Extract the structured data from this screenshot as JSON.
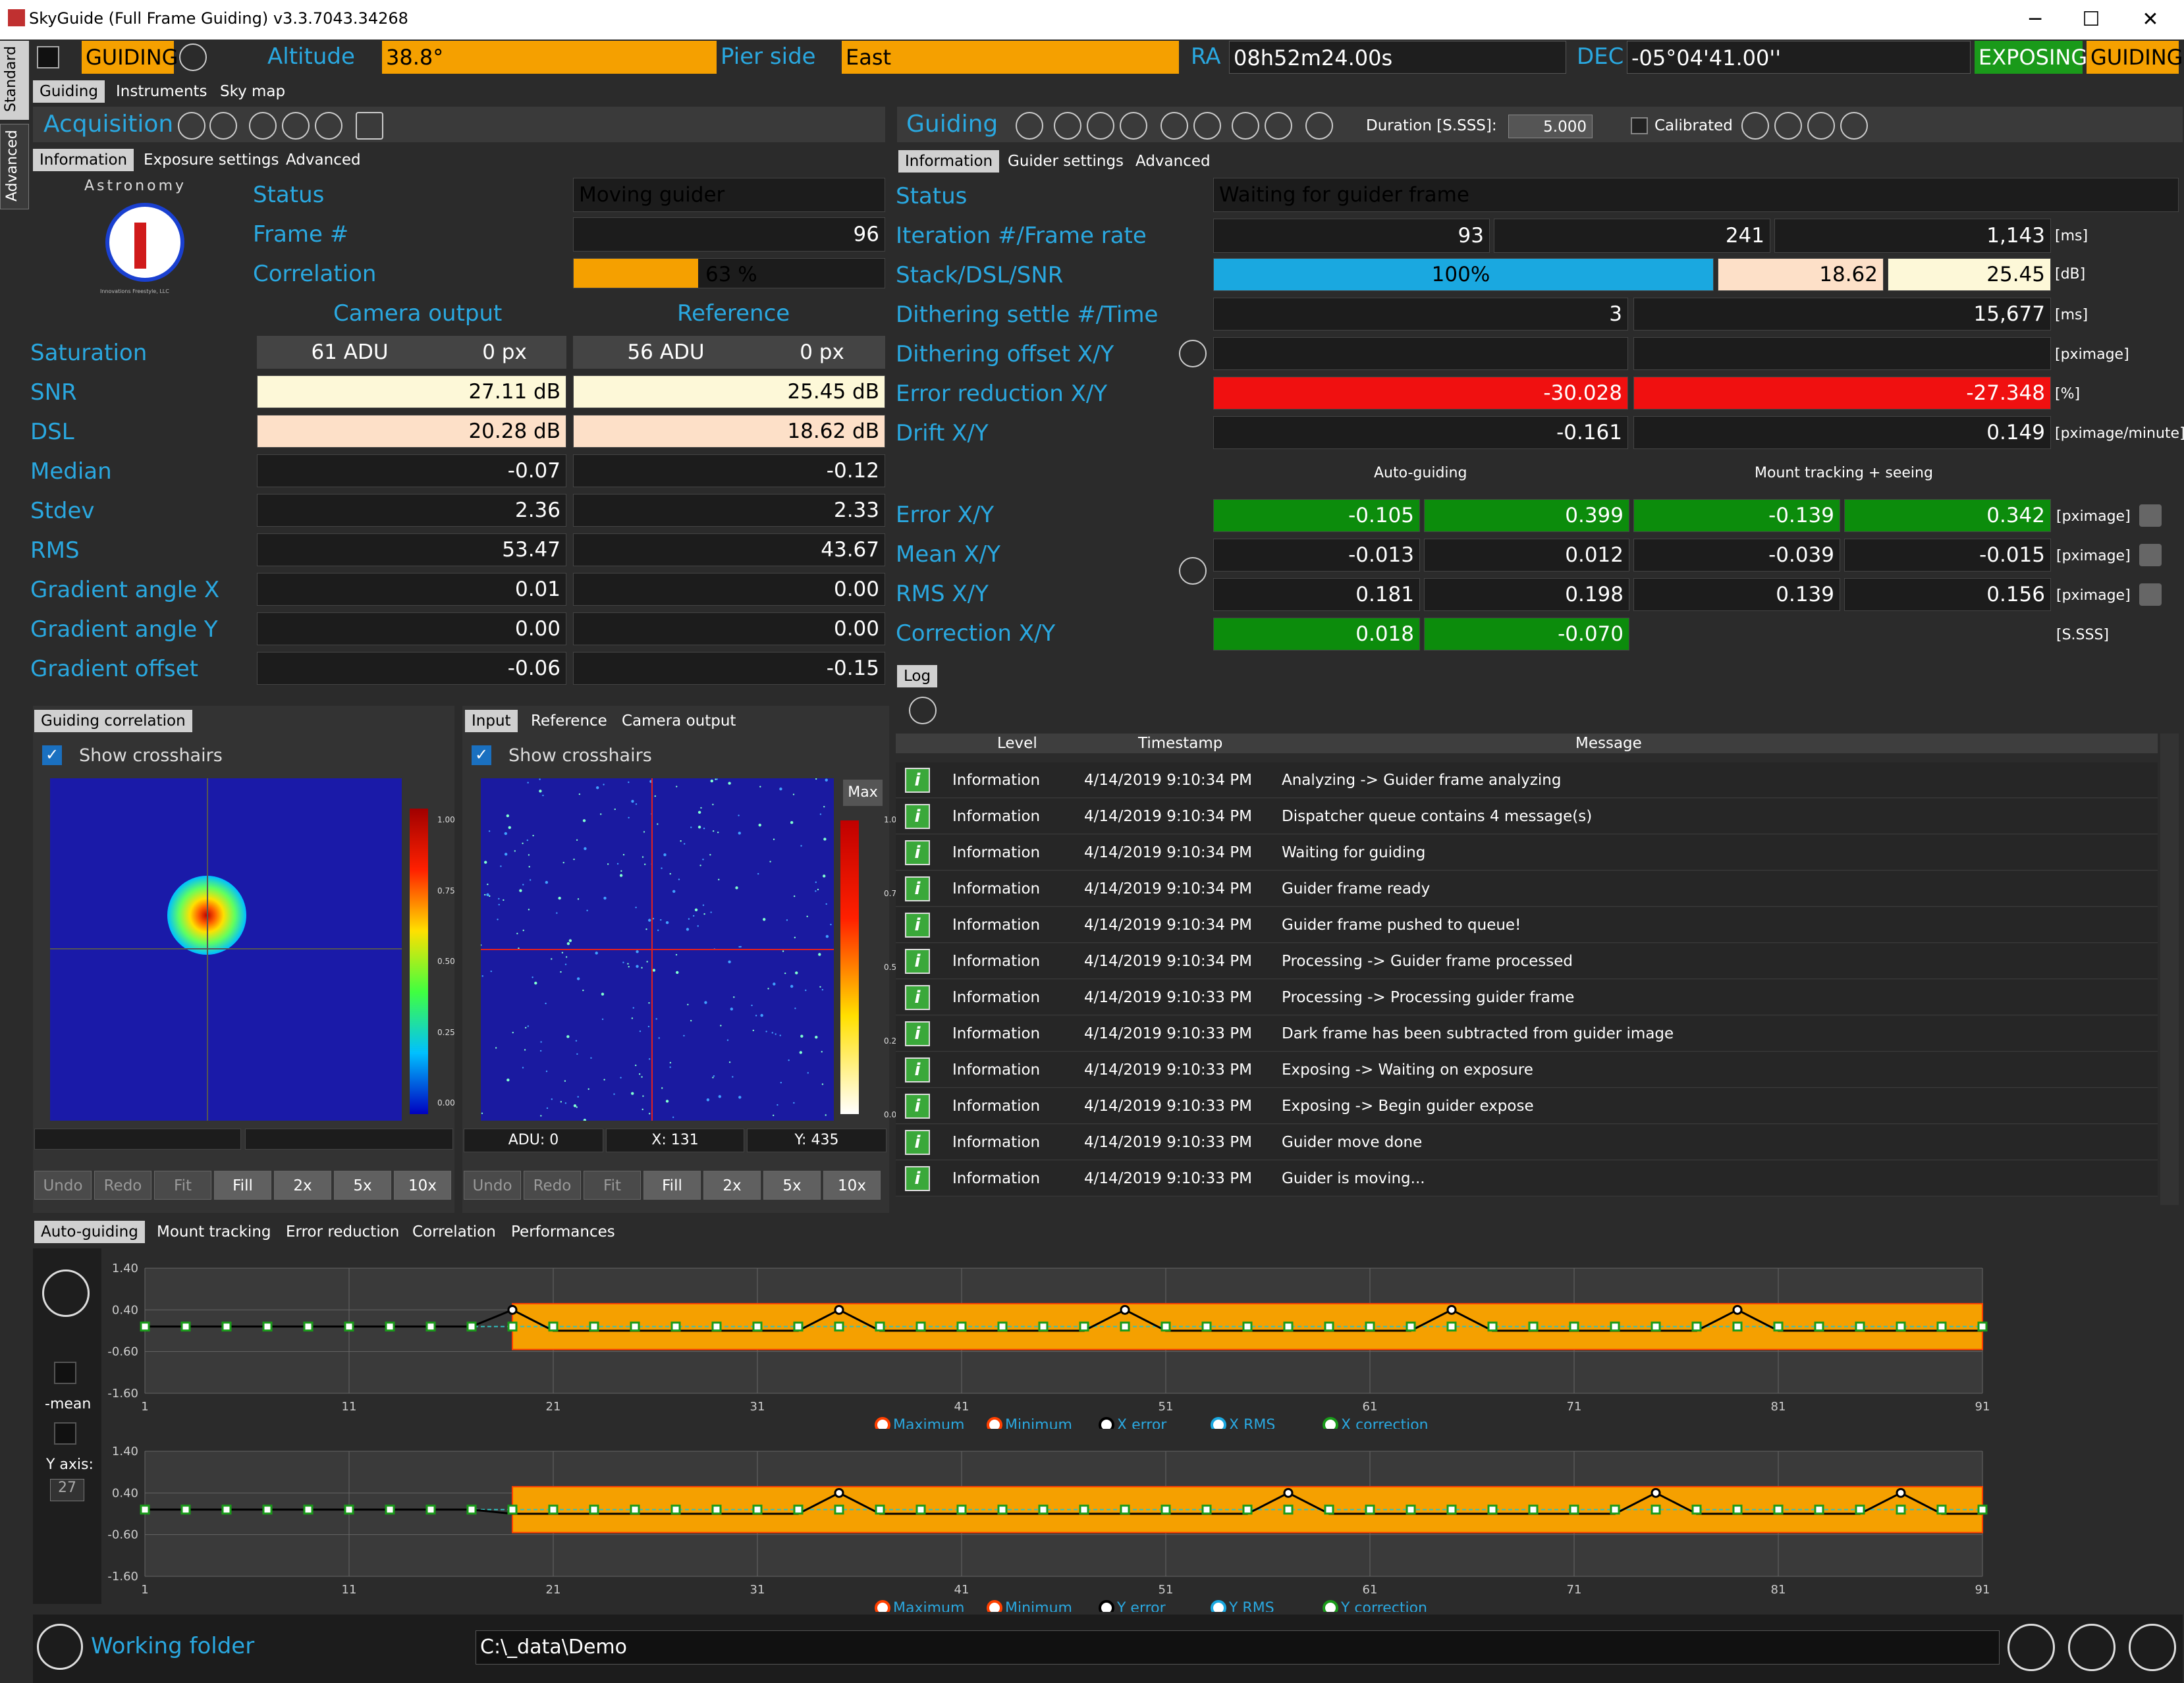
{
  "window": {
    "title": "SkyGuide (Full Frame Guiding) v3.3.7043.34268"
  },
  "statusbar": {
    "mode": "GUIDING",
    "altitude_label": "Altitude",
    "altitude": "38.8°",
    "pier_label": "Pier side",
    "pier": "East",
    "ra_label": "RA",
    "ra": "08h52m24.00s",
    "dec_label": "DEC",
    "dec": "-05°04'41.00''",
    "exposing": "EXPOSING",
    "guiding": "GUIDING"
  },
  "sidetabs": [
    "Standard",
    "Advanced"
  ],
  "maintabs": [
    "Guiding",
    "Instruments",
    "Sky map"
  ],
  "acq": {
    "title": "Acquisition",
    "tabs": [
      "Information",
      "Exposure settings",
      "Advanced"
    ],
    "logo_letters": "Astronomy",
    "logo_fine": "Innovations Freestyle, LLC",
    "status_label": "Status",
    "status": "Moving guider",
    "frame_label": "Frame #",
    "frame": "96",
    "corr_label": "Correlation",
    "corr": "63 %",
    "corr_pct": 63,
    "cam_head": "Camera output",
    "ref_head": "Reference",
    "rows": [
      {
        "label": "Saturation",
        "c": "61 ADU",
        "cpx": "0 px",
        "r": "56 ADU",
        "rpx": "0 px"
      },
      {
        "label": "SNR",
        "c": "27.11 dB",
        "r": "25.45 dB"
      },
      {
        "label": "DSL",
        "c": "20.28 dB",
        "r": "18.62 dB"
      },
      {
        "label": "Median",
        "c": "-0.07",
        "r": "-0.12"
      },
      {
        "label": "Stdev",
        "c": "2.36",
        "r": "2.33"
      },
      {
        "label": "RMS",
        "c": "53.47",
        "r": "43.67"
      },
      {
        "label": "Gradient angle X",
        "c": "0.01",
        "r": "0.00"
      },
      {
        "label": "Gradient angle Y",
        "c": "0.00",
        "r": "0.00"
      },
      {
        "label": "Gradient offset",
        "c": "-0.06",
        "r": "-0.15"
      }
    ]
  },
  "guide": {
    "title": "Guiding",
    "tabs": [
      "Information",
      "Guider settings",
      "Advanced"
    ],
    "duration_label": "Duration [S.SSS]:",
    "duration": "5.000",
    "calibrated": "Calibrated",
    "status_label": "Status",
    "status": "Waiting for guider frame",
    "iter_label": "Iteration #/Frame rate",
    "iter": "93",
    "iter2": "241",
    "rate": "1,143",
    "ms": "[ms]",
    "stack_label": "Stack/DSL/SNR",
    "stack": "100%",
    "dsl": "18.62",
    "snr": "25.45",
    "db": "[dB]",
    "dith_label": "Dithering settle #/Time",
    "dith_n": "3",
    "dith_t": "15,677",
    "ms2": "[ms]",
    "doff_label": "Dithering offset X/Y",
    "pximage": "[pximage]",
    "er_label": "Error reduction X/Y",
    "erx": "-30.028",
    "ery": "-27.348",
    "pct": "[%]",
    "drift_label": "Drift X/Y",
    "driftx": "-0.161",
    "drifty": "0.149",
    "pxmin": "[pximage/minute]",
    "auto_head": "Auto-guiding",
    "mount_head": "Mount tracking + seeing",
    "err_label": "Error X/Y",
    "err": [
      "-0.105",
      "0.399",
      "-0.139",
      "0.342"
    ],
    "mean_label": "Mean X/Y",
    "mean": [
      "-0.013",
      "0.012",
      "-0.039",
      "-0.015"
    ],
    "rms_label": "RMS X/Y",
    "rms": [
      "0.181",
      "0.198",
      "0.139",
      "0.156"
    ],
    "cor_label": "Correction X/Y",
    "cor": [
      "0.018",
      "-0.070"
    ],
    "sss": "[S.SSS]",
    "pxu": "[pximage]"
  },
  "imgL": {
    "tab": "Guiding correlation",
    "cross": "Show crosshairs",
    "btns": [
      "Undo",
      "Redo",
      "Fit",
      "Fill",
      "2x",
      "5x",
      "10x"
    ]
  },
  "imgR": {
    "tabs": [
      "Input",
      "Reference",
      "Camera output"
    ],
    "cross": "Show crosshairs",
    "max": "Max",
    "adu": "ADU: 0",
    "x": "X: 131",
    "y": "Y: 435",
    "btns": [
      "Undo",
      "Redo",
      "Fit",
      "Fill",
      "2x",
      "5x",
      "10x"
    ]
  },
  "scale": [
    "1.00",
    "0.75",
    "0.50",
    "0.25",
    "0.00"
  ],
  "log": {
    "tab": "Log",
    "cols": [
      "Level",
      "Timestamp",
      "Message"
    ],
    "rows": [
      [
        "Information",
        "4/14/2019 9:10:34 PM",
        "Analyzing -> Guider frame analyzing"
      ],
      [
        "Information",
        "4/14/2019 9:10:34 PM",
        "Dispatcher queue contains 4 message(s)"
      ],
      [
        "Information",
        "4/14/2019 9:10:34 PM",
        "Waiting for guiding"
      ],
      [
        "Information",
        "4/14/2019 9:10:34 PM",
        "Guider frame ready"
      ],
      [
        "Information",
        "4/14/2019 9:10:34 PM",
        "Guider frame pushed to queue!"
      ],
      [
        "Information",
        "4/14/2019 9:10:34 PM",
        "Processing -> Guider frame processed"
      ],
      [
        "Information",
        "4/14/2019 9:10:33 PM",
        "Processing -> Processing guider frame"
      ],
      [
        "Information",
        "4/14/2019 9:10:33 PM",
        "Dark frame has been subtracted from guider image"
      ],
      [
        "Information",
        "4/14/2019 9:10:33 PM",
        "Exposing -> Waiting on exposure"
      ],
      [
        "Information",
        "4/14/2019 9:10:33 PM",
        "Exposing -> Begin guider expose"
      ],
      [
        "Information",
        "4/14/2019 9:10:33 PM",
        "Guider move done"
      ],
      [
        "Information",
        "4/14/2019 9:10:33 PM",
        "Guider is moving..."
      ]
    ]
  },
  "charts": {
    "tabs": [
      "Auto-guiding",
      "Mount tracking",
      "Error reduction",
      "Correlation",
      "Performances"
    ],
    "side": {
      "mean": "-mean",
      "yaxis": "Y axis:",
      "yval": "27"
    },
    "yticks": [
      "1.40",
      "0.40",
      "-0.60",
      "-1.60"
    ],
    "xticks": [
      "1",
      "11",
      "21",
      "31",
      "41",
      "51",
      "61",
      "71",
      "81",
      "91"
    ],
    "legendX": [
      "Maximum",
      "Minimum",
      "X error",
      "X RMS",
      "X correction"
    ],
    "legendY": [
      "Maximum",
      "Minimum",
      "Y error",
      "Y RMS",
      "Y correction"
    ]
  },
  "chart_data": [
    {
      "type": "line",
      "ylim": [
        -1.6,
        1.4
      ],
      "xlim": [
        1,
        91
      ],
      "legend": "bottom",
      "x_start": 19,
      "x_end": 91,
      "max_band": 0.55,
      "min_band": -0.55,
      "series": [
        {
          "name": "X error",
          "peaks": [
            19,
            35,
            49,
            65,
            79
          ],
          "peak": 0.4,
          "base": -0.1
        }
      ]
    },
    {
      "type": "line",
      "ylim": [
        -1.6,
        1.4
      ],
      "xlim": [
        1,
        91
      ],
      "legend": "bottom",
      "x_start": 19,
      "x_end": 91,
      "max_band": 0.55,
      "min_band": -0.55,
      "series": [
        {
          "name": "Y error",
          "peaks": [
            35,
            57,
            75,
            87
          ],
          "peak": 0.4,
          "base": -0.1
        }
      ]
    }
  ],
  "footer": {
    "label": "Working folder",
    "path": "C:\\_data\\Demo"
  }
}
